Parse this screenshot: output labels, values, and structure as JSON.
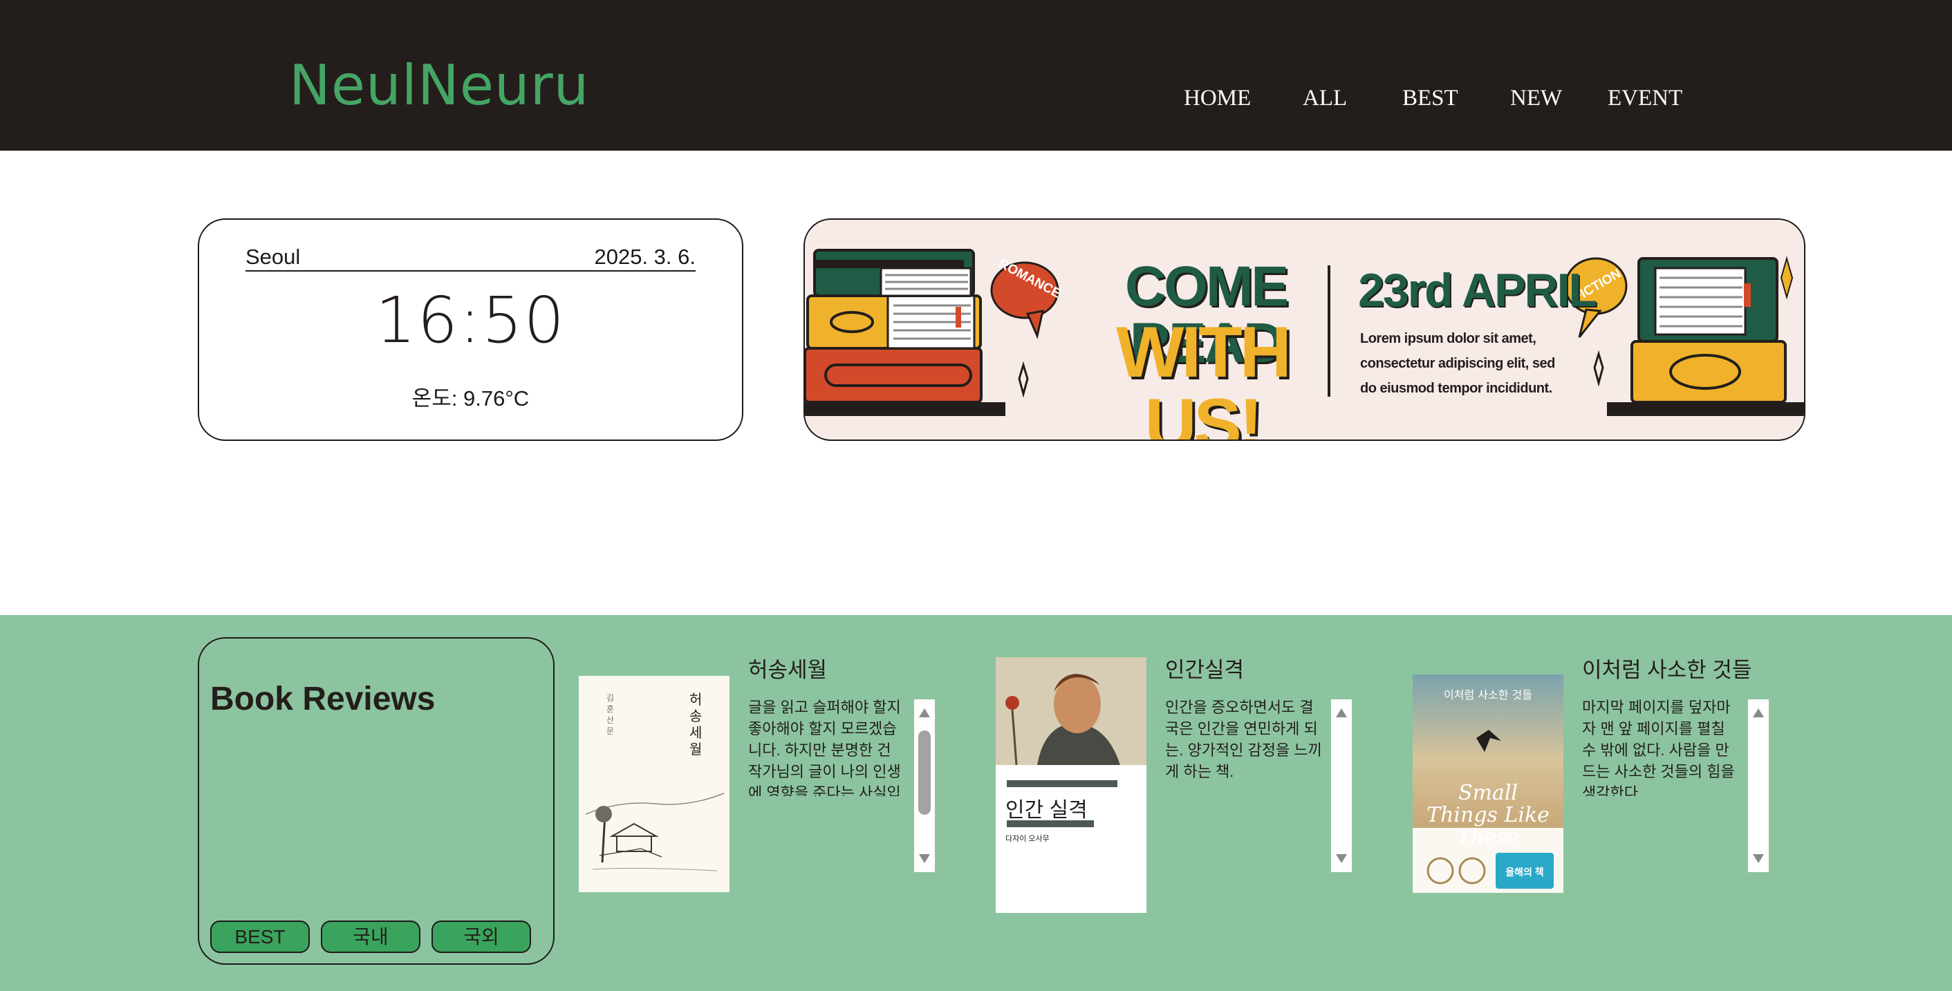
{
  "header": {
    "logo": "NeulNeuru",
    "nav": [
      "HOME",
      "ALL",
      "BEST",
      "NEW",
      "EVENT"
    ]
  },
  "info": {
    "city": "Seoul",
    "date": "2025. 3. 6.",
    "time": "16:50",
    "temp": "온도: 9.76°C"
  },
  "banner": {
    "tag_left": "ROMANCE",
    "tag_right": "FICTION",
    "title_line1": "COME READ",
    "title_line2": "WITH US!",
    "event_date": "23rd APRIL",
    "lorem": "Lorem ipsum dolor sit amet, consectetur adipiscing elit, sed do eiusmod tempor incididunt."
  },
  "reviews": {
    "heading": "Book Reviews",
    "filters": [
      "BEST",
      "국내",
      "국외"
    ],
    "books": [
      {
        "title": "허송세월",
        "text": "글을 읽고 슬퍼해야 할지 좋아해야 할지 모르겠습니다. 하지만 분명한 건 작가님의 글이 나의 인생에 영향을 준다는 사실입니다. 신간이 나와서 이토록 기쁜 적도, 이토록 슬펐던 적도 없었던 거 같습니다. 작가님의 다음 책을 기다립니다.",
        "cover_title": "허송세월",
        "cover_author": "김훈 산문"
      },
      {
        "title": "인간실격",
        "text": "인간을 증오하면서도 결국은 인간을 연민하게 되는. 양가적인 감정을 느끼게 하는 책.",
        "cover_title": "인간 실격",
        "cover_author": "다자이 오사무"
      },
      {
        "title": "이처럼 사소한 것들",
        "text": "마지막 페이지를 덮자마자 맨 앞 페이지를 펼칠 수 밖에 없다. 사람을 만드는 사소한 것들의 힘을 생각한다",
        "cover_title": "이처럼 사소한 것들",
        "cover_en": "Small Things Like These",
        "cover_badge": "올해의 책"
      }
    ]
  },
  "colors": {
    "header_bg": "#231e1b",
    "logo": "#45a565",
    "reviews_bg": "#8cc4a0",
    "button_bg": "#3aa35d",
    "banner_bg": "#f6ebe7",
    "banner_green": "#1f5b45",
    "banner_yellow": "#f0b22a",
    "banner_red": "#d34a2a"
  }
}
